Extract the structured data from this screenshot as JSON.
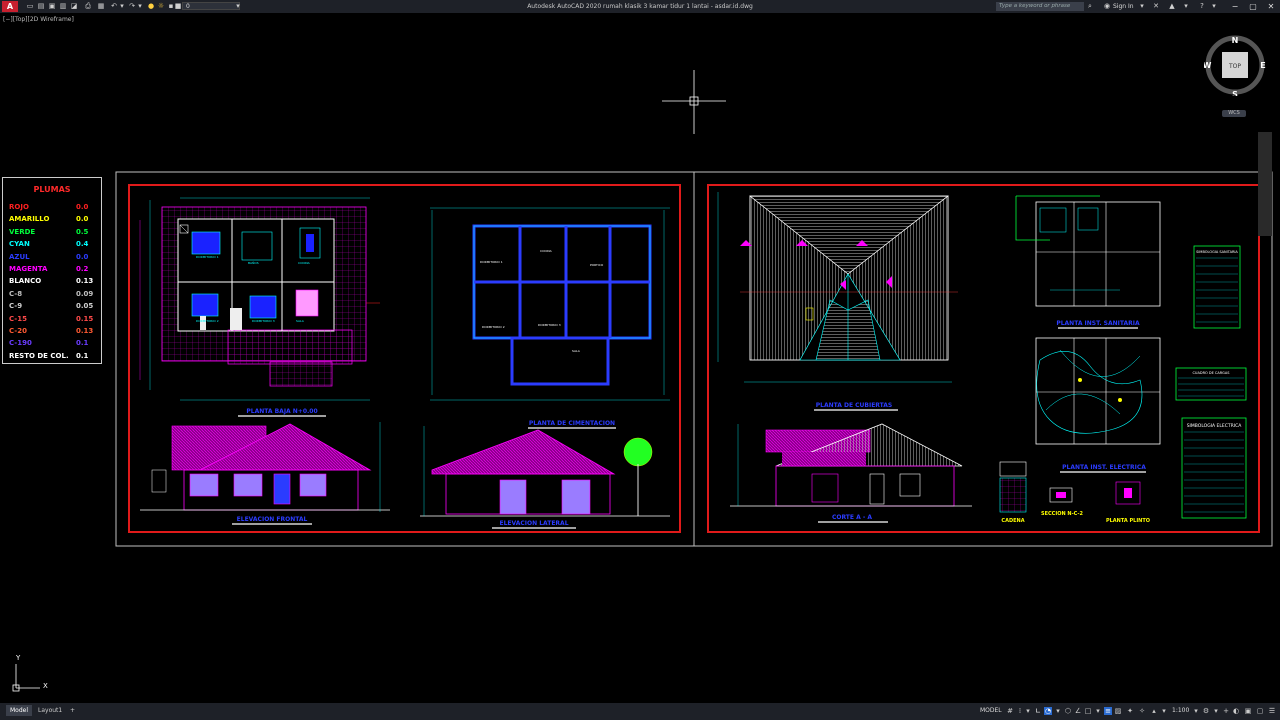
{
  "app": {
    "window_title": "Autodesk AutoCAD 2020   rumah klasik 3 kamar tidur 1 lantai - asdar.id.dwg",
    "layer_value": "0",
    "search_placeholder": "Type a keyword or phrase",
    "signin_label": "Sign In"
  },
  "viewport": {
    "label": "[−][Top][2D Wireframe]"
  },
  "viewcube": {
    "top_label": "TOP",
    "north": "N",
    "south": "S",
    "east": "E",
    "west": "W",
    "wcs_label": "WCS"
  },
  "pen_legend": {
    "title": "PLUMAS",
    "rows": [
      {
        "name": "ROJO",
        "value": "0.0",
        "color": "#ff2020"
      },
      {
        "name": "AMARILLO",
        "value": "0.0",
        "color": "#ffff00"
      },
      {
        "name": "VERDE",
        "value": "0.5",
        "color": "#00ff3c"
      },
      {
        "name": "CYAN",
        "value": "0.4",
        "color": "#00ffff"
      },
      {
        "name": "AZUL",
        "value": "0.0",
        "color": "#2b3cff"
      },
      {
        "name": "MAGENTA",
        "value": "0.2",
        "color": "#ff00ff"
      },
      {
        "name": "BLANCO",
        "value": "0.13",
        "color": "#ffffff"
      },
      {
        "name": "C-8",
        "value": "0.09",
        "color": "#c0c0c0"
      },
      {
        "name": "C-9",
        "value": "0.05",
        "color": "#d0d0d0"
      },
      {
        "name": "C-15",
        "value": "0.15",
        "color": "#ff4a4a"
      },
      {
        "name": "C-20",
        "value": "0.13",
        "color": "#ff5a32"
      },
      {
        "name": "C-190",
        "value": "0.1",
        "color": "#6a3cff"
      },
      {
        "name": "RESTO DE COL.",
        "value": "0.1",
        "color": "#ffffff"
      }
    ]
  },
  "drawing_labels": {
    "planta_baja": "PLANTA BAJA N+0.00",
    "planta_cimentacion": "PLANTA DE CIMENTACION",
    "elevacion_frontal": "ELEVACION FRONTAL",
    "elevacion_lateral": "ELEVACION LATERAL",
    "planta_cubiertas": "PLANTA DE CUBIERTAS",
    "planta_sanitaria": "PLANTA INST. SANITARIA",
    "planta_electrica": "PLANTA INST. ELECTRICA",
    "corte": "CORTE A - A",
    "cadena": "CADENA",
    "seccion": "SECCION N-C-2",
    "planta_plinto": "PLANTA PLINTO",
    "simbologia_electrica": "SIMBOLOGIA ELECTRICA",
    "simbologia_sanitaria": "SIMBOLOGIA SANITARIA",
    "cuadro_cargas": "CUADRO DE CARGAS",
    "dormitorio_1": "DORMITORIO 1",
    "dormitorio_2": "DORMITORIO 2",
    "dormitorio_3": "DORMITORIO 3",
    "cocina": "COCINA",
    "sala": "SALA",
    "comedor": "COMEDOR",
    "portico": "PORTICO",
    "banos": "BAÑOS"
  },
  "ucs": {
    "x": "X",
    "y": "Y"
  },
  "status": {
    "tabs": [
      "Model",
      "Layout1",
      "+"
    ],
    "model_label": "MODEL",
    "scale": "1:100"
  },
  "colors": {
    "background": "#000000",
    "frame_red": "#e01a1a",
    "magenta": "#ff00ff",
    "cyan": "#00ffff",
    "blue": "#2b3cff"
  }
}
